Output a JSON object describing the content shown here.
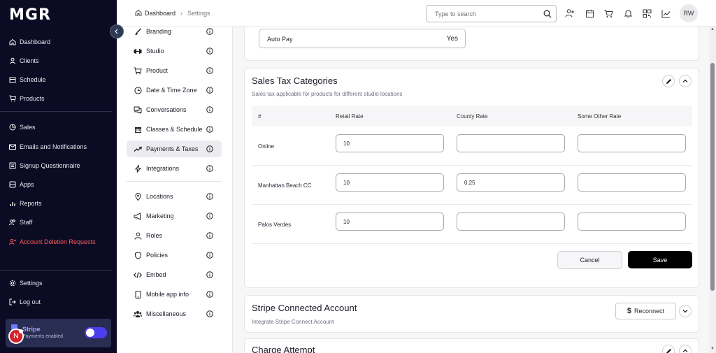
{
  "app": {
    "logo": "MGR"
  },
  "sidebar": {
    "items": [
      {
        "label": "Dashboard",
        "icon": "home-icon"
      },
      {
        "label": "Clients",
        "icon": "user-icon"
      },
      {
        "label": "Schedule",
        "icon": "calendar-icon"
      },
      {
        "label": "Products",
        "icon": "cart-icon"
      },
      {
        "label": "Sales",
        "icon": "pie-icon"
      },
      {
        "label": "Emails and Notifications",
        "icon": "mail-icon"
      },
      {
        "label": "Signup Questionnaire",
        "icon": "form-icon"
      },
      {
        "label": "Apps",
        "icon": "apps-icon"
      },
      {
        "label": "Reports",
        "icon": "bar-chart-icon"
      },
      {
        "label": "Staff",
        "icon": "users-icon"
      },
      {
        "label": "Account Deletion Requests",
        "icon": "user-x-icon"
      }
    ],
    "bottom": [
      {
        "label": "Settings",
        "icon": "gear-icon"
      },
      {
        "label": "Log out",
        "icon": "logout-icon"
      }
    ],
    "stripe": {
      "name": "Stripe",
      "status": "Payments enabled",
      "enabled": true
    },
    "badge": "N"
  },
  "header": {
    "breadcrumb": [
      "Dashboard",
      "Settings"
    ],
    "search_placeholder": "Type to search",
    "avatar_initials": "RW"
  },
  "settings_menu": {
    "group1": [
      {
        "label": "Branding",
        "icon": "brush-icon"
      },
      {
        "label": "Studio",
        "icon": "dumbbell-icon"
      },
      {
        "label": "Product",
        "icon": "cart-icon"
      },
      {
        "label": "Date & Time Zone",
        "icon": "clock-icon"
      },
      {
        "label": "Conversations",
        "icon": "chat-icon"
      },
      {
        "label": "Classes & Schedule",
        "icon": "calendar-icon"
      },
      {
        "label": "Payments & Taxes",
        "icon": "trend-icon",
        "active": true
      },
      {
        "label": "Integrations",
        "icon": "bolt-icon"
      }
    ],
    "group2": [
      {
        "label": "Locations",
        "icon": "pin-icon"
      },
      {
        "label": "Marketing",
        "icon": "megaphone-icon"
      },
      {
        "label": "Roles",
        "icon": "user-icon"
      },
      {
        "label": "Policies",
        "icon": "shield-icon"
      },
      {
        "label": "Embed",
        "icon": "code-icon"
      },
      {
        "label": "Mobile app info",
        "icon": "phone-icon"
      },
      {
        "label": "Miscellaneous",
        "icon": "users-icon"
      }
    ]
  },
  "autopay": {
    "label": "Auto Pay",
    "value": "Yes"
  },
  "sales_tax": {
    "title": "Sales Tax Categories",
    "subtitle": "Sales tax applicable for products for different studio locations",
    "columns": [
      "#",
      "Retail Rate",
      "County Rate",
      "Some Other Rate"
    ],
    "rows": [
      {
        "name": "Online",
        "retail": "10",
        "county": "",
        "other": ""
      },
      {
        "name": "Manhattan Beach CC",
        "retail": "10",
        "county": "0.25",
        "other": ""
      },
      {
        "name": "Palos Verdes",
        "retail": "10",
        "county": "",
        "other": ""
      }
    ],
    "cancel_label": "Cancel",
    "save_label": "Save"
  },
  "stripe_connected": {
    "title": "Stripe Connected Account",
    "subtitle": "Integrate Stripe Connect Account",
    "reconnect_label": "Reconnect",
    "reconnect_symbol": "$"
  },
  "charge_attempt": {
    "title": "Charge Attempt"
  }
}
